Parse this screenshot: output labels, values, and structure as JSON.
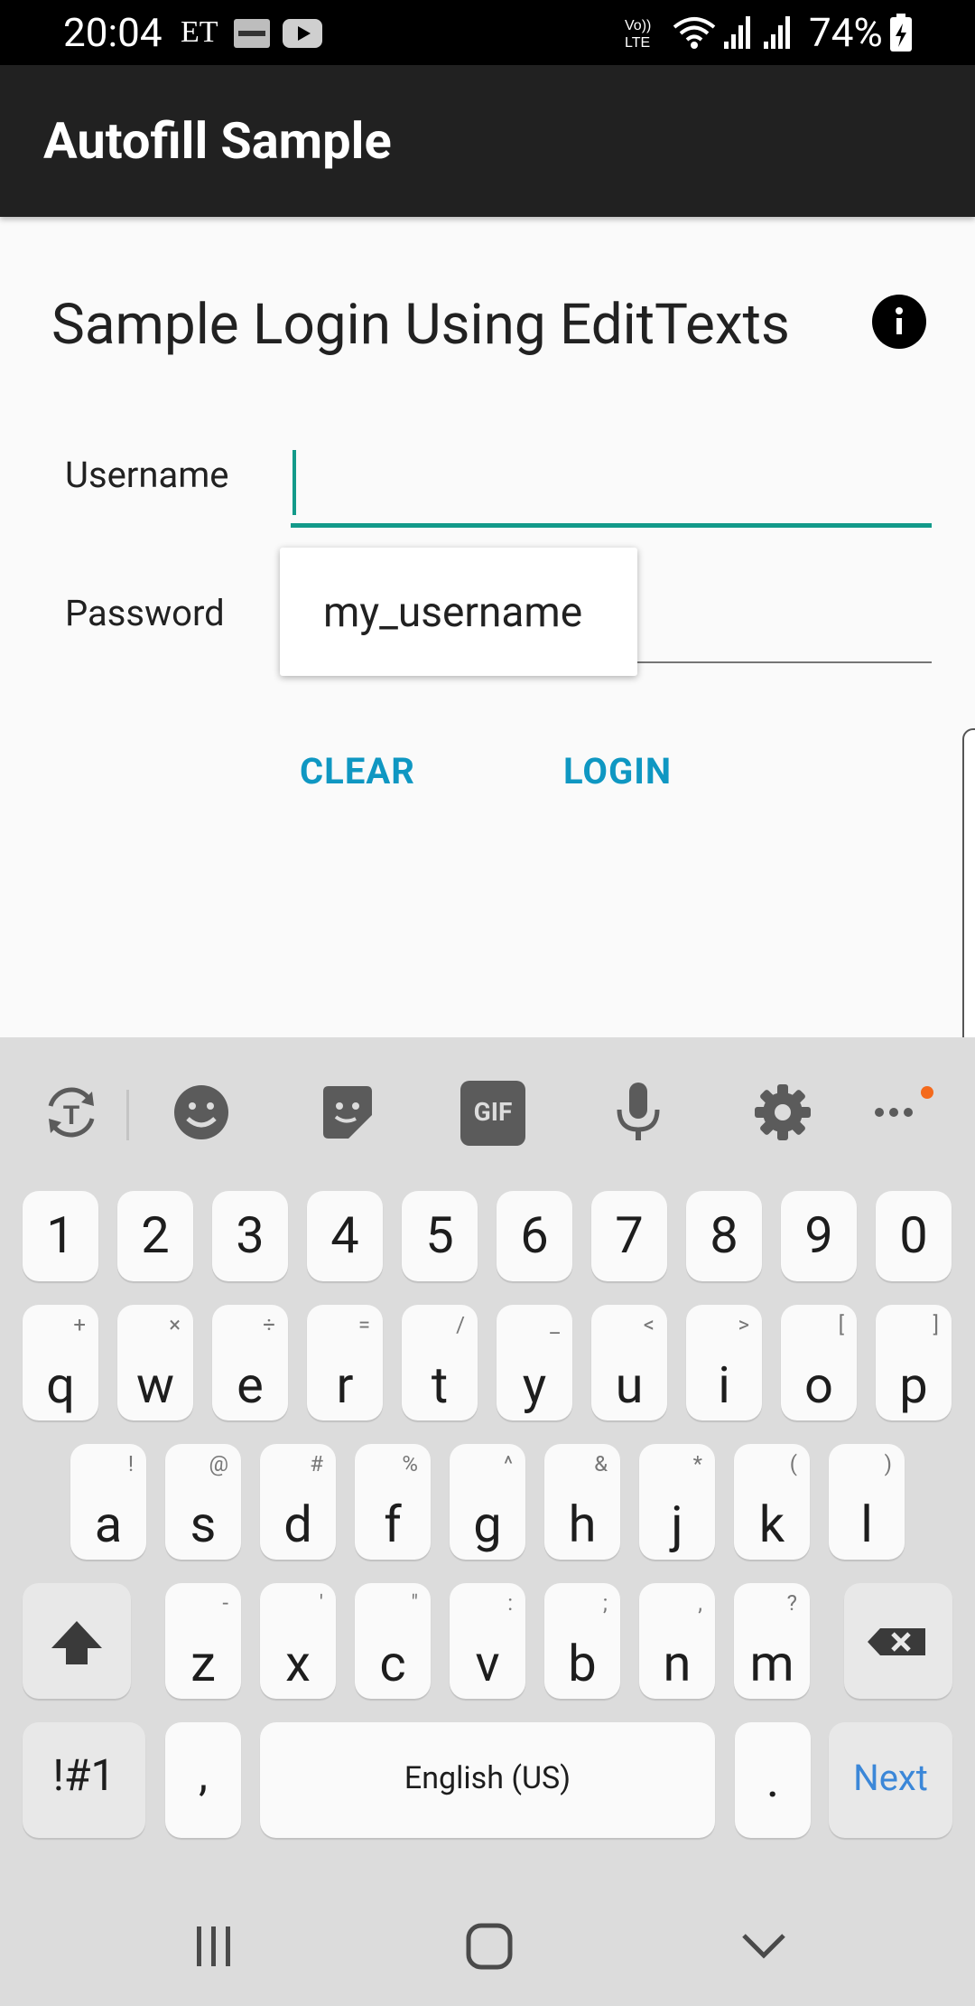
{
  "status_bar": {
    "time": "20:04",
    "et": "ET",
    "battery": "74%",
    "icons": [
      "zomato-icon",
      "youtube-icon",
      "volte-icon",
      "wifi-icon",
      "signal-icon",
      "signal-icon",
      "battery-icon"
    ]
  },
  "app_bar": {
    "title": "Autofill Sample"
  },
  "content": {
    "heading": "Sample Login Using EditTexts",
    "username_label": "Username",
    "password_label": "Password",
    "username_value": "",
    "password_value": "",
    "autofill_suggestion": "my_username",
    "clear_button": "CLEAR",
    "login_button": "LOGIN",
    "accent_color": "#129a8a",
    "button_color": "#0f97c2"
  },
  "keyboard": {
    "toolbar": [
      "translate-icon",
      "emoji-icon",
      "sticker-icon",
      "gif-icon",
      "mic-icon",
      "settings-icon",
      "more-icon"
    ],
    "gif_label": "GIF",
    "number_row": [
      "1",
      "2",
      "3",
      "4",
      "5",
      "6",
      "7",
      "8",
      "9",
      "0"
    ],
    "row1": [
      {
        "key": "q",
        "sub": "+"
      },
      {
        "key": "w",
        "sub": "×"
      },
      {
        "key": "e",
        "sub": "÷"
      },
      {
        "key": "r",
        "sub": "="
      },
      {
        "key": "t",
        "sub": "/"
      },
      {
        "key": "y",
        "sub": "_"
      },
      {
        "key": "u",
        "sub": "<"
      },
      {
        "key": "i",
        "sub": ">"
      },
      {
        "key": "o",
        "sub": "["
      },
      {
        "key": "p",
        "sub": "]"
      }
    ],
    "row2": [
      {
        "key": "a",
        "sub": "!"
      },
      {
        "key": "s",
        "sub": "@"
      },
      {
        "key": "d",
        "sub": "#"
      },
      {
        "key": "f",
        "sub": "%"
      },
      {
        "key": "g",
        "sub": "^"
      },
      {
        "key": "h",
        "sub": "&"
      },
      {
        "key": "j",
        "sub": "*"
      },
      {
        "key": "k",
        "sub": "("
      },
      {
        "key": "l",
        "sub": ")"
      }
    ],
    "row3": [
      {
        "key": "z",
        "sub": "-"
      },
      {
        "key": "x",
        "sub": "'"
      },
      {
        "key": "c",
        "sub": "\""
      },
      {
        "key": "v",
        "sub": ":"
      },
      {
        "key": "b",
        "sub": ";"
      },
      {
        "key": "n",
        "sub": ","
      },
      {
        "key": "m",
        "sub": "?"
      }
    ],
    "symbols_key": "!#1",
    "comma_key": ",",
    "space_key": "English (US)",
    "period_key": ".",
    "action_key": "Next"
  },
  "nav_bar": [
    "recents-icon",
    "home-icon",
    "back-icon"
  ]
}
